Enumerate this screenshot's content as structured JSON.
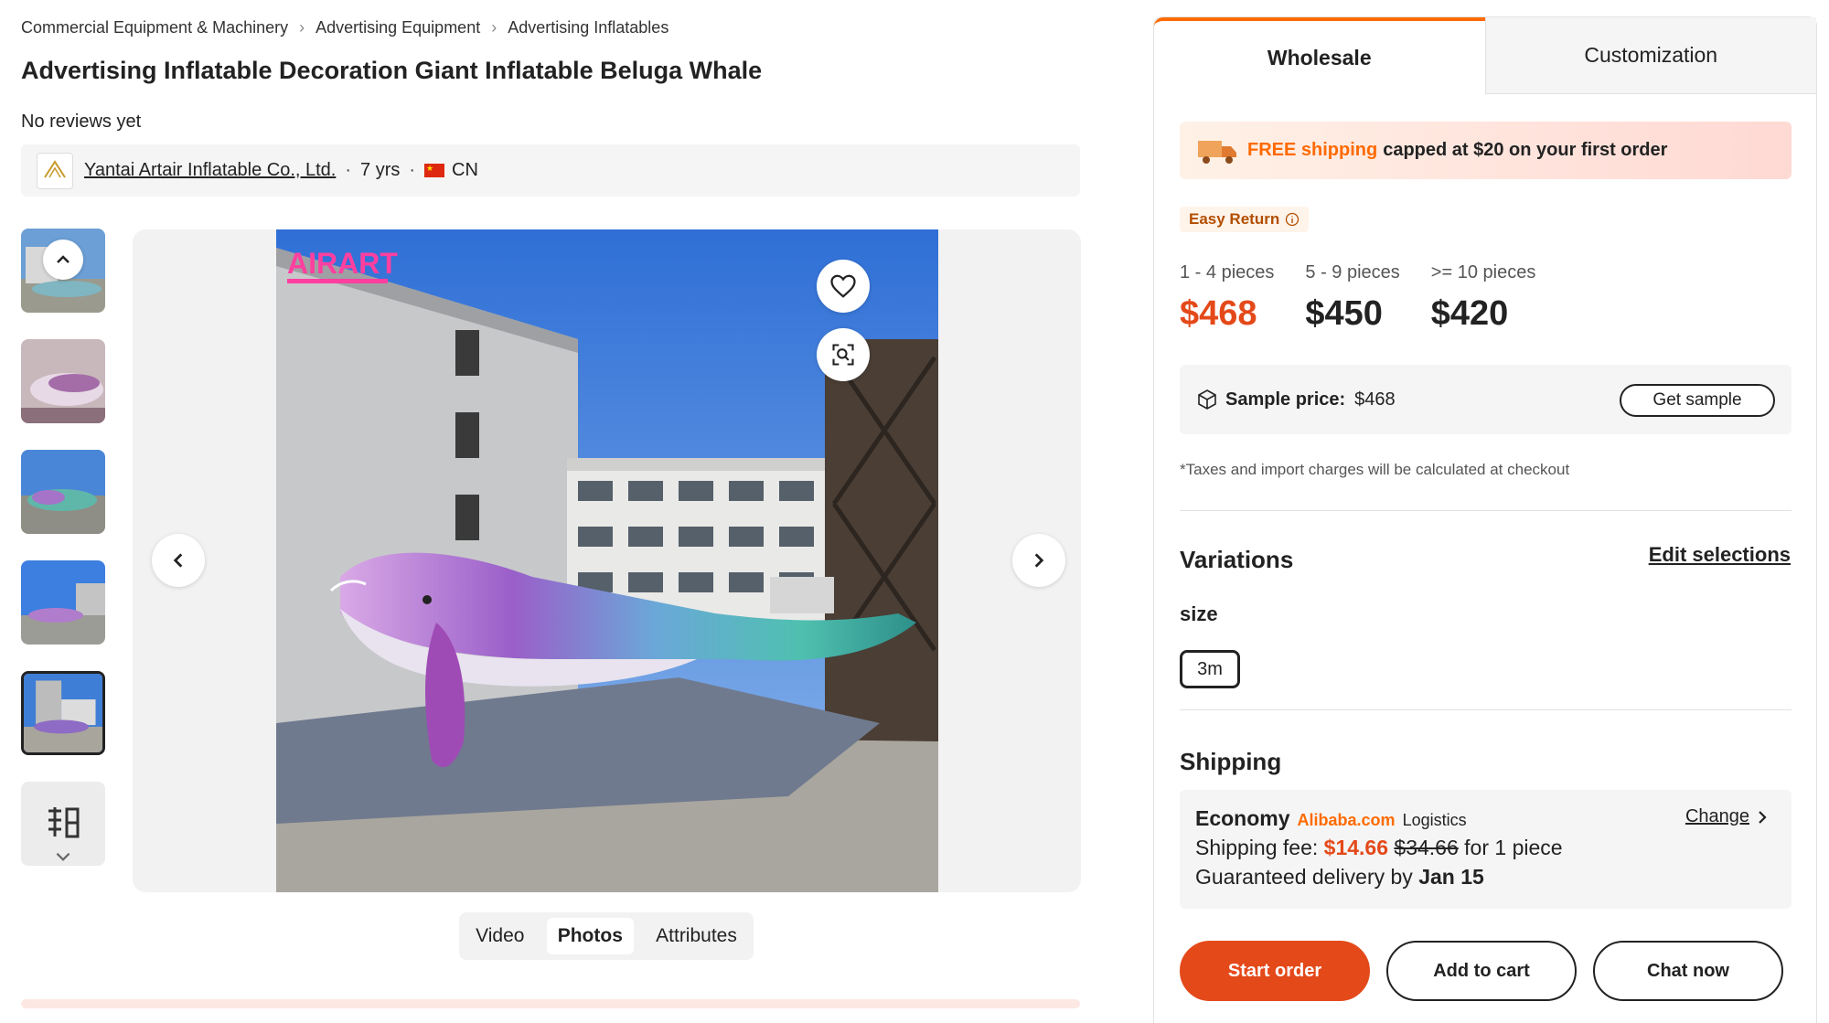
{
  "breadcrumbs": [
    "Commercial Equipment & Machinery",
    "Advertising Equipment",
    "Advertising Inflatables"
  ],
  "product": {
    "title": "Advertising Inflatable Decoration Giant Inflatable Beluga Whale",
    "reviews": "No reviews yet"
  },
  "supplier": {
    "name": "Yantai Artair Inflatable Co., Ltd.",
    "years": "7 yrs",
    "country": "CN",
    "logo_text": "AIRART"
  },
  "photo": {
    "watermark": "AIRART"
  },
  "media_tabs": [
    {
      "label": "Video"
    },
    {
      "label": "Photos"
    },
    {
      "label": "Attributes"
    }
  ],
  "panel": {
    "tabs": [
      {
        "label": "Wholesale"
      },
      {
        "label": "Customization"
      }
    ],
    "shipping_banner": {
      "highlight": "FREE shipping",
      "text": "capped at $20 on your first order"
    },
    "easy_return": "Easy Return",
    "tiers": [
      {
        "qty": "1 - 4 pieces",
        "price": "$468"
      },
      {
        "qty": "5 - 9 pieces",
        "price": "$450"
      },
      {
        "qty": ">= 10 pieces",
        "price": "$420"
      }
    ],
    "sample": {
      "label": "Sample price:",
      "price": "$468",
      "button": "Get sample"
    },
    "taxes_note": "*Taxes and import charges will be calculated at checkout",
    "variations": {
      "title": "Variations",
      "edit": "Edit selections",
      "size_label": "size",
      "size_value": "3m"
    },
    "shipping": {
      "title": "Shipping",
      "method": "Economy",
      "carrier": "Alibaba.com",
      "carrier_suffix": "Logistics",
      "change": "Change",
      "fee_label": "Shipping fee:",
      "fee": "$14.66",
      "fee_original": "$34.66",
      "fee_suffix": "for 1 piece",
      "delivery_label": "Guaranteed delivery by",
      "delivery_date": "Jan 15"
    },
    "buttons": {
      "start": "Start order",
      "cart": "Add to cart",
      "chat": "Chat now"
    }
  },
  "colors": {
    "accent": "#e4491a",
    "orange": "#ff6a00"
  }
}
